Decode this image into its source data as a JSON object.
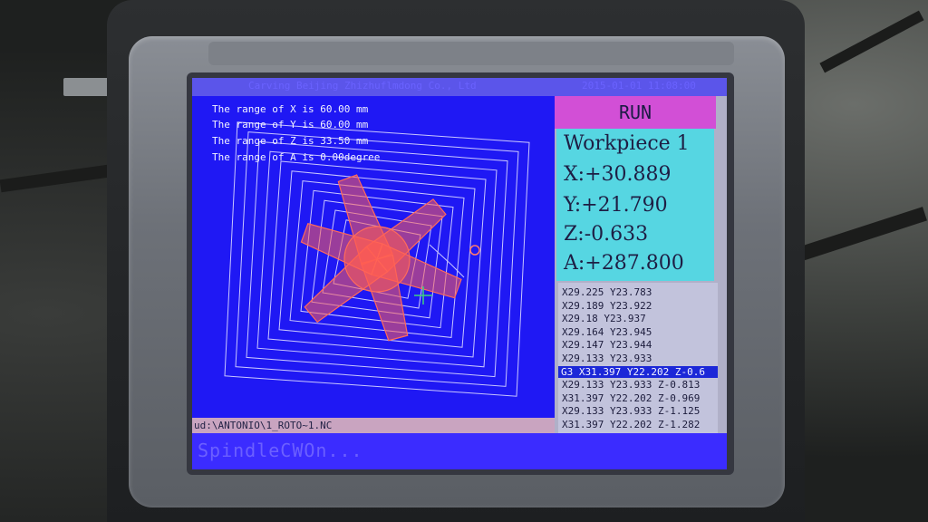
{
  "window": {
    "title": "Carving Beijing Zhizhuflmdong Co., Ltd",
    "clock": "2015-01-01 11:08:00"
  },
  "ranges": [
    "The range of X is 60.00 mm",
    "The range of Y is 60.00 mm",
    "The range of Z is 33.50 mm",
    "The range of A is 0.00degree"
  ],
  "status_panel": {
    "mode": "RUN",
    "workpiece": "Workpiece 1",
    "x": "X:+30.889",
    "y": "Y:+21.790",
    "z": "Z:-0.633",
    "a": "A:+287.800"
  },
  "gcode_lines": [
    "X29.225 Y23.783",
    "X29.189 Y23.922",
    "X29.18 Y23.937",
    "X29.164 Y23.945",
    "X29.147 Y23.944",
    "X29.133 Y23.933",
    "G3 X31.397 Y22.202 Z-0.6",
    "X29.133 Y23.933 Z-0.813",
    "X31.397 Y22.202 Z-0.969",
    "X29.133 Y23.933 Z-1.125",
    "X31.397 Y22.202 Z-1.282"
  ],
  "gcode_highlight_index": 6,
  "file_path": "ud:\\ANTONIO\\1_ROTO~1.NC",
  "status_message": "SpindleCWOn...",
  "colors": {
    "screen_bg": "#1f18f4",
    "run_bg": "#d24fd6",
    "coords_bg": "#56d6e2",
    "toolpath": "#ff6a5a"
  }
}
